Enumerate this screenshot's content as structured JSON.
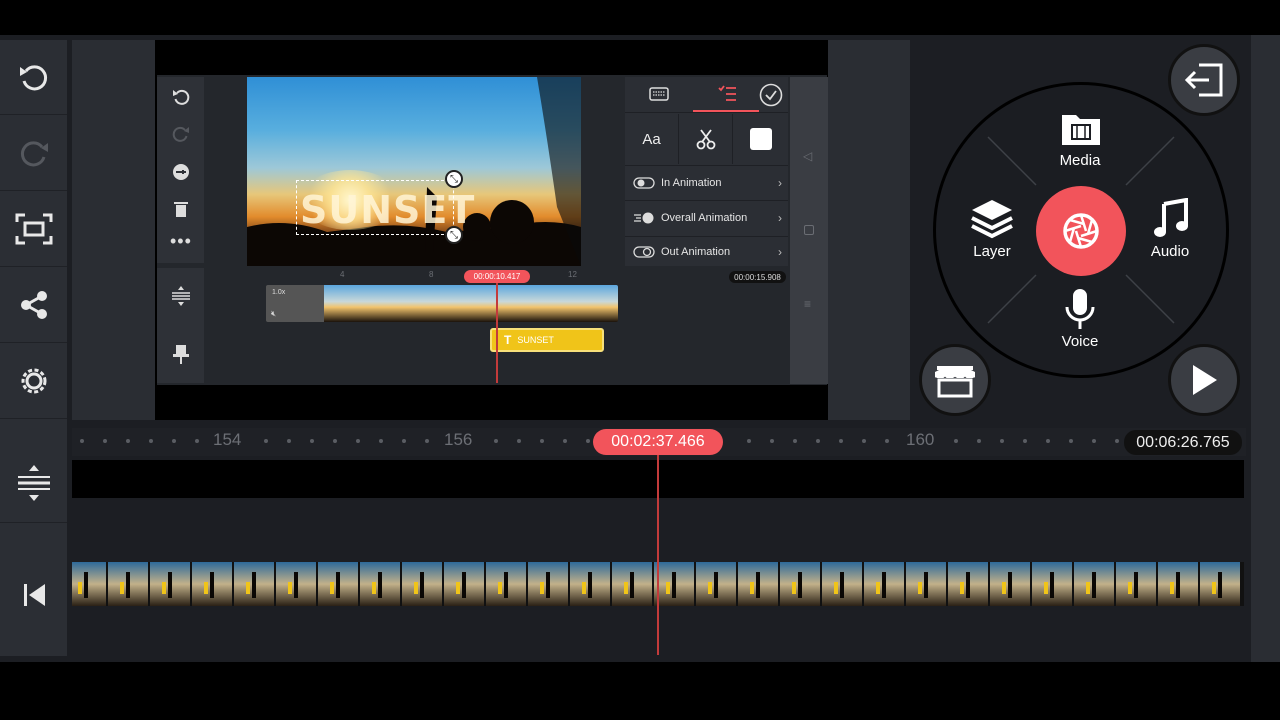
{
  "preview": {
    "overlay_text": "SUNSET",
    "current_time": "00:00:10.417",
    "total_time": "00:00:15.908",
    "ruler_marks": [
      "4",
      "8",
      "12"
    ],
    "clip_speed": "1.0x",
    "text_layer_label": "SUNSET",
    "options": [
      {
        "label": "In Animation"
      },
      {
        "label": "Overall Animation"
      },
      {
        "label": "Out Animation"
      }
    ],
    "tool_font_label": "Aa"
  },
  "circle_menu": {
    "media": "Media",
    "layer": "Layer",
    "audio": "Audio",
    "voice": "Voice"
  },
  "timeline": {
    "current_time": "00:02:37.466",
    "total_time": "00:06:26.765",
    "ruler_numbers": [
      "154",
      "156",
      "160"
    ]
  },
  "colors": {
    "accent": "#f2545b",
    "text_layer": "#f0c419",
    "background": "#1c1e23"
  }
}
